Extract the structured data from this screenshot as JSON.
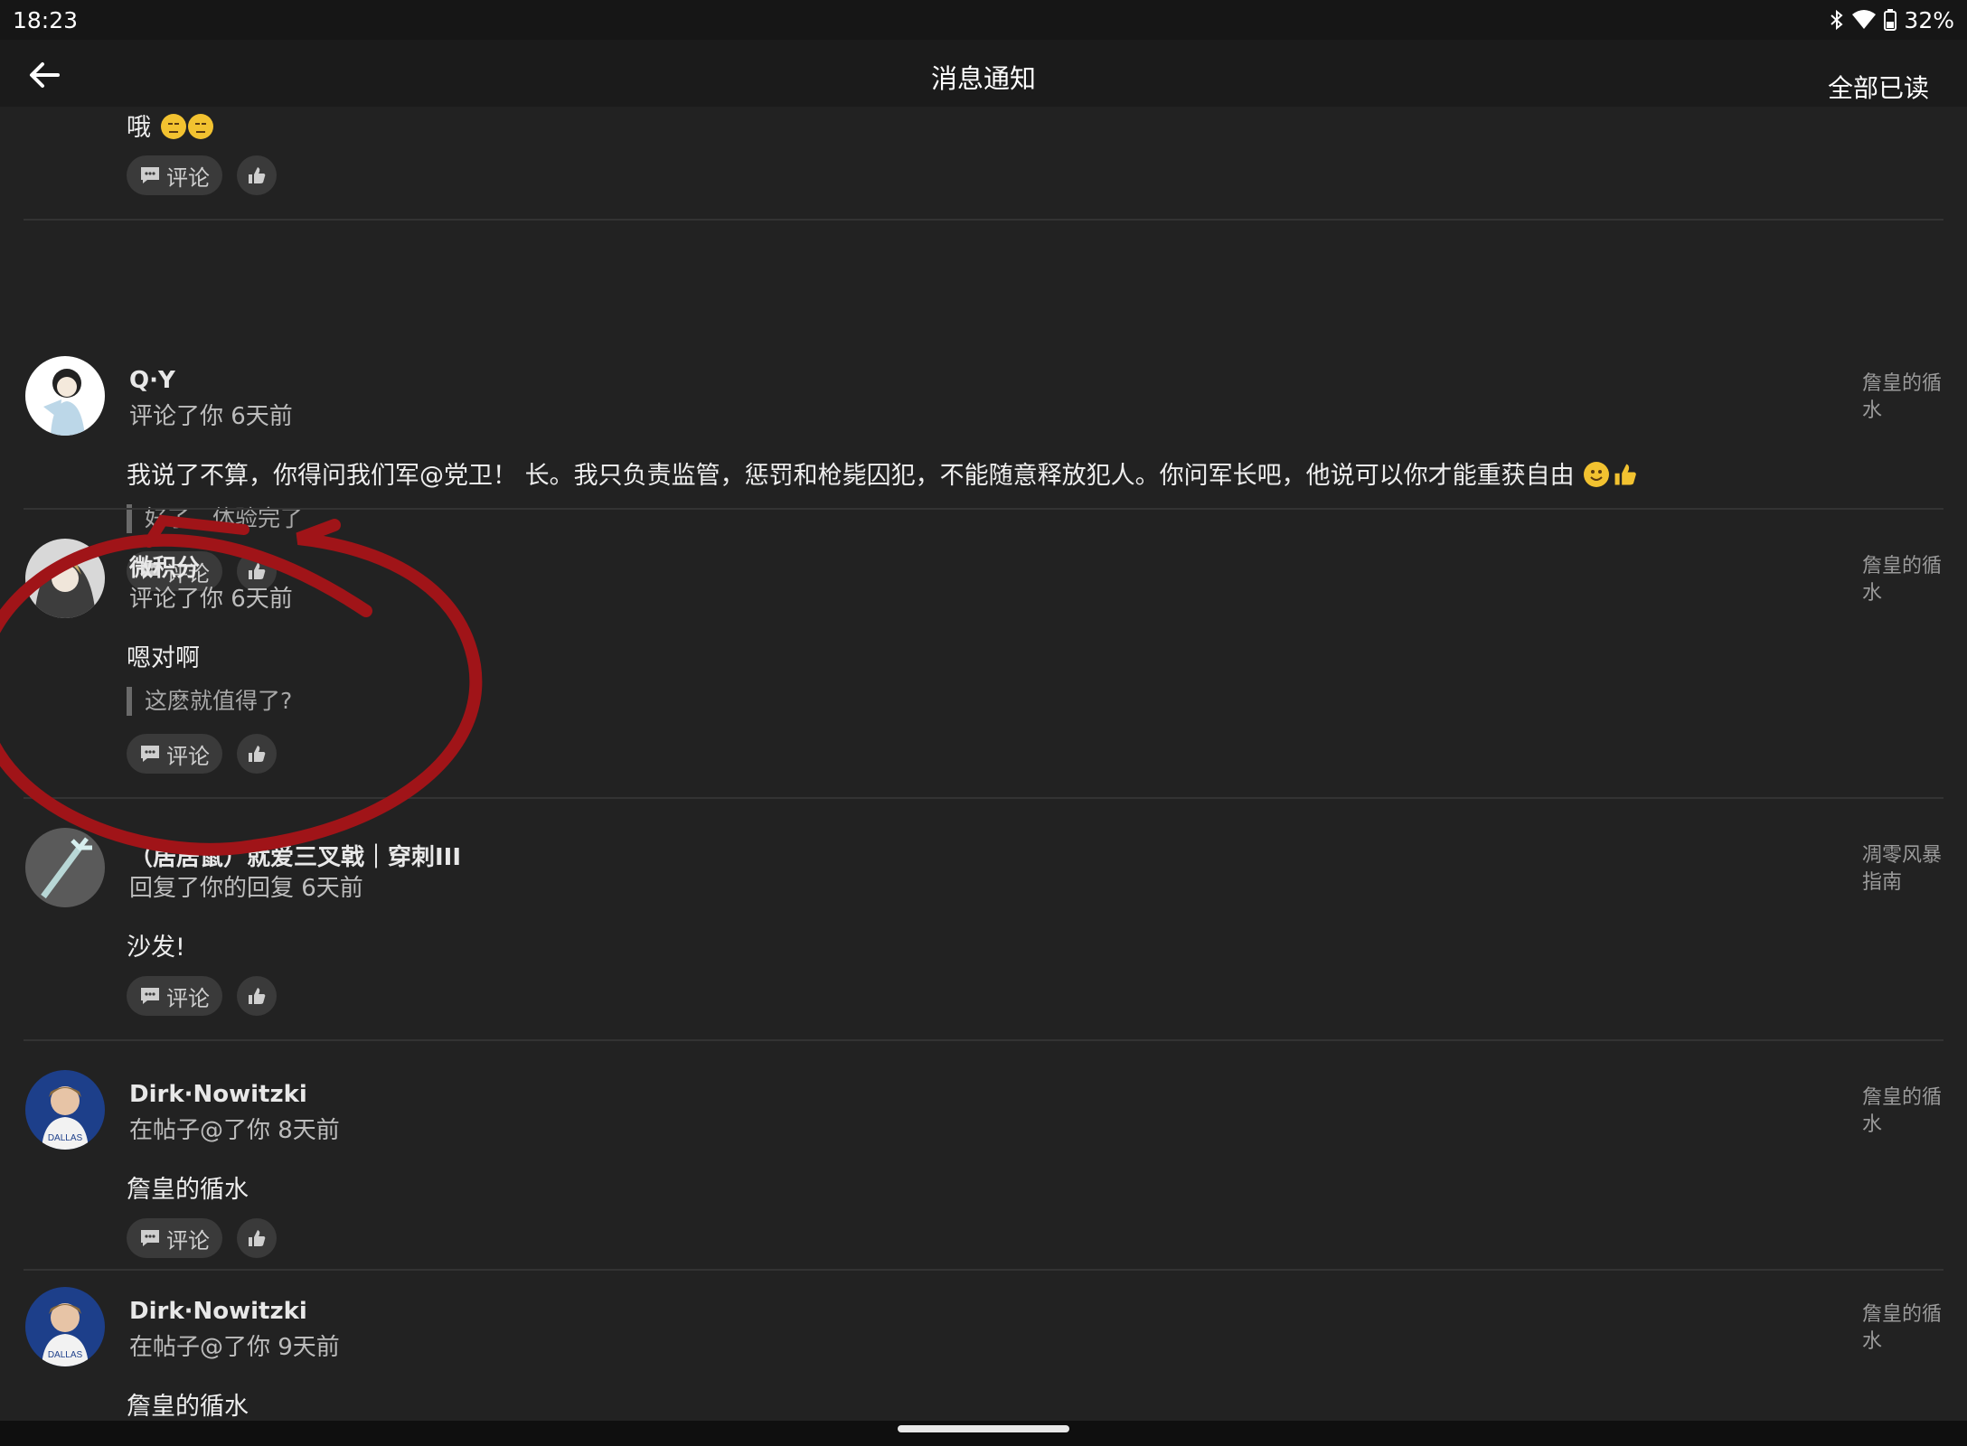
{
  "status_bar": {
    "time": "18:23",
    "battery": "32%",
    "icons": [
      "bluetooth-icon",
      "wifi-icon",
      "battery-icon"
    ]
  },
  "header": {
    "title": "消息通知",
    "mark_all_read": "全部已读",
    "back_icon": "back-arrow-icon"
  },
  "actions": {
    "comment_label": "评论",
    "comment_icon": "comment-icon",
    "like_icon": "thumbs-up-icon"
  },
  "notifications": [
    {
      "username": "",
      "meta": "",
      "source": "",
      "content": "哦",
      "content_emoji": [
        "unamused-emoji",
        "unamused-emoji"
      ],
      "quote": ""
    },
    {
      "username": "Q·Y",
      "meta": "评论了你 6天前",
      "source": "詹皇的循水",
      "content": "我说了不算，你得问我们军@党卫！ 长。我只负责监管，惩罚和枪毙囚犯，不能随意释放犯人。你问军长吧，他说可以你才能重获自由",
      "content_emoji": [
        "smile-emoji",
        "thumbs-up-emoji"
      ],
      "quote": "好了，体验完了"
    },
    {
      "username": "微积分",
      "meta": "评论了你 6天前",
      "source": "詹皇的循水",
      "content": "嗯对啊",
      "content_emoji": [],
      "quote": "这麽就值得了?"
    },
    {
      "username": "（居居鼠）就爱三叉戟｜穿刺III",
      "meta": "回复了你的回复 6天前",
      "source": "凋零风暴指南",
      "content": "沙发!",
      "content_emoji": [],
      "quote": ""
    },
    {
      "username": "Dirk·Nowitzki",
      "meta": "在帖子@了你 8天前",
      "source": "詹皇的循水",
      "content": "詹皇的循水",
      "content_emoji": [],
      "quote": ""
    },
    {
      "username": "Dirk·Nowitzki",
      "meta": "在帖子@了你 9天前",
      "source": "詹皇的循水",
      "content": "詹皇的循水",
      "content_emoji": [],
      "quote": ""
    }
  ],
  "colors": {
    "background": "#222222",
    "annotation": "#a01418",
    "appbar": "#1b1b1b"
  }
}
